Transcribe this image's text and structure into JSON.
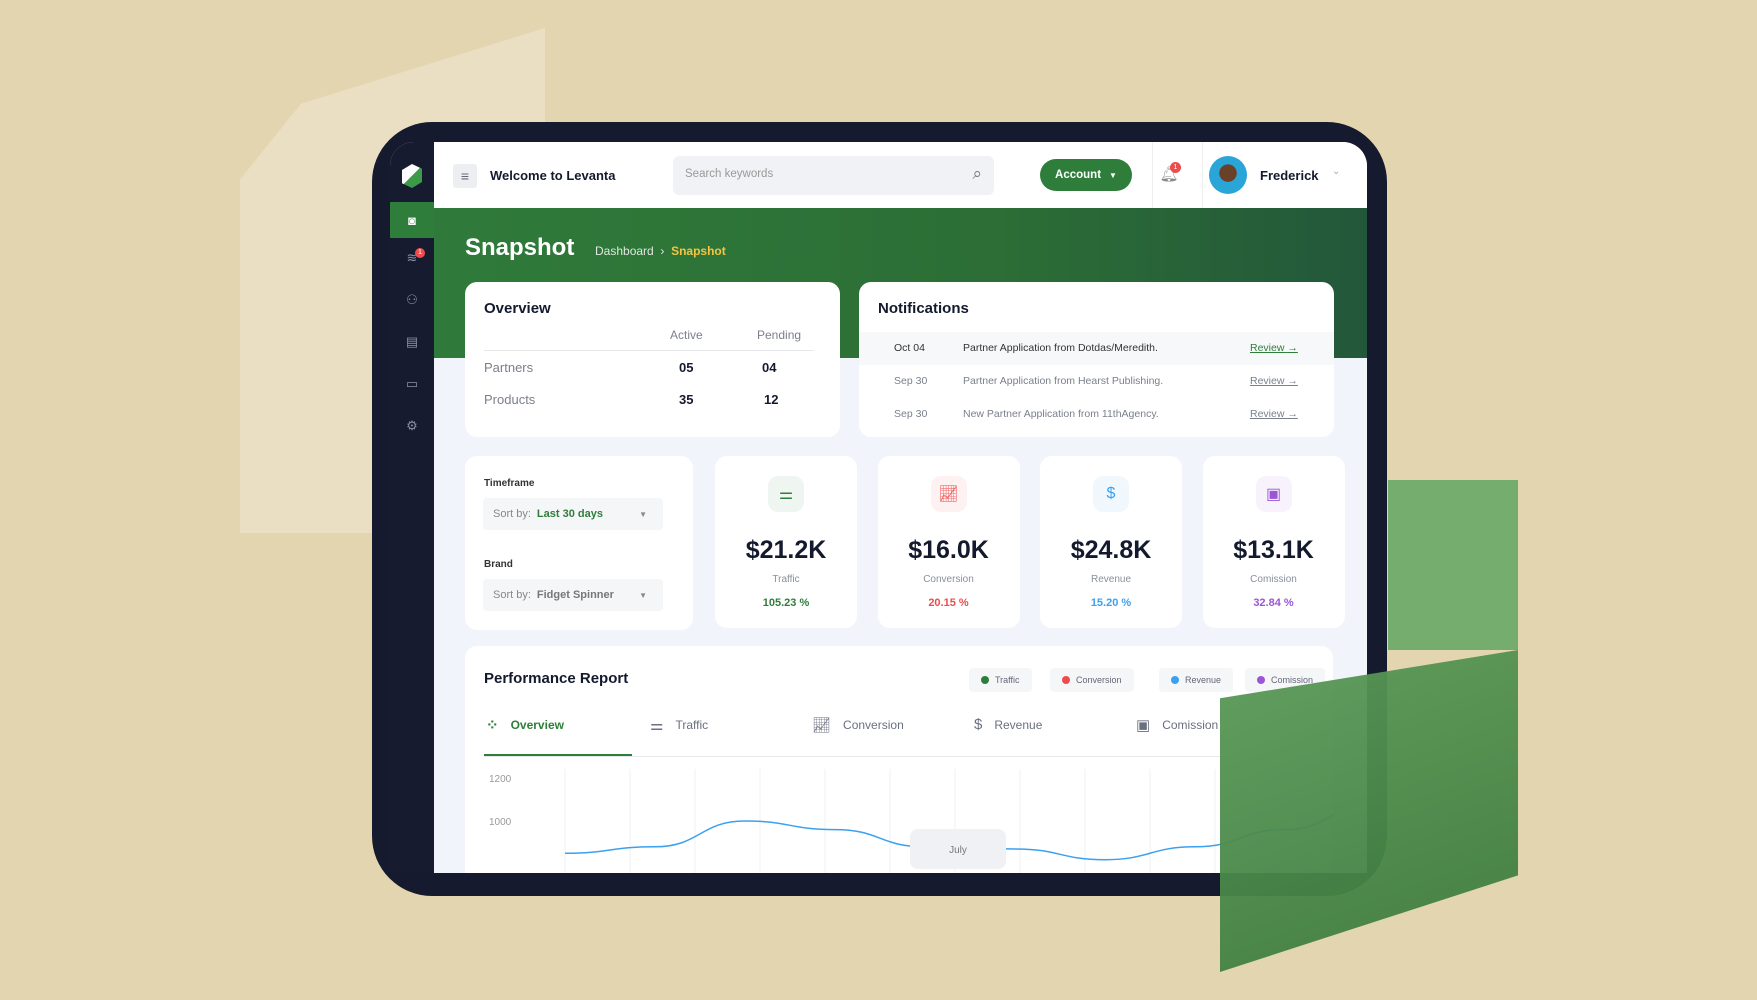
{
  "header": {
    "title": "Welcome to Levanta",
    "search_placeholder": "Search keywords",
    "account_label": "Account",
    "notification_count": "1",
    "user_name": "Frederick"
  },
  "sidebar": {
    "items": [
      {
        "icon": "camera-icon",
        "active": true
      },
      {
        "icon": "layers-icon",
        "badge": "1"
      },
      {
        "icon": "users-icon"
      },
      {
        "icon": "document-icon"
      },
      {
        "icon": "card-icon"
      },
      {
        "icon": "gear-icon"
      }
    ]
  },
  "page": {
    "title": "Snapshot",
    "breadcrumb": [
      "Dashboard",
      "Snapshot"
    ]
  },
  "overview": {
    "title": "Overview",
    "columns": [
      "Active",
      "Pending"
    ],
    "rows": [
      {
        "label": "Partners",
        "active": "05",
        "pending": "04"
      },
      {
        "label": "Products",
        "active": "35",
        "pending": "12"
      }
    ]
  },
  "notifications": {
    "title": "Notifications",
    "items": [
      {
        "date": "Oct 04",
        "text": "Partner Application from Dotdas/Meredith.",
        "action": "Review"
      },
      {
        "date": "Sep 30",
        "text": "Partner Application from Hearst Publishing.",
        "action": "Review"
      },
      {
        "date": "Sep 30",
        "text": "New Partner Application from 11thAgency.",
        "action": "Review"
      }
    ]
  },
  "filters": {
    "timeframe_label": "Timeframe",
    "timeframe_prefix": "Sort by:",
    "timeframe_value": "Last 30 days",
    "brand_label": "Brand",
    "brand_prefix": "Sort by:",
    "brand_value": "Fidget Spinner"
  },
  "stats": [
    {
      "value": "$21.2K",
      "label": "Traffic",
      "pct": "105.23 %",
      "color": "#2f7d3b",
      "icon": "sliders-icon"
    },
    {
      "value": "$16.0K",
      "label": "Conversion",
      "pct": "20.15 %",
      "color": "#ef4b4b",
      "icon": "trend-chart-icon"
    },
    {
      "value": "$24.8K",
      "label": "Revenue",
      "pct": "15.20 %",
      "color": "#3aa1f0",
      "icon": "dollar-bill-icon"
    },
    {
      "value": "$13.1K",
      "label": "Comission",
      "pct": "32.84 %",
      "color": "#9b55d6",
      "icon": "cash-icon"
    }
  ],
  "performance": {
    "title": "Performance Report",
    "legend": [
      {
        "label": "Traffic",
        "color": "#2f7d3b"
      },
      {
        "label": "Conversion",
        "color": "#ef4b4b"
      },
      {
        "label": "Revenue",
        "color": "#3aa1f0"
      },
      {
        "label": "Comission",
        "color": "#9b55d6"
      }
    ],
    "tabs": [
      {
        "label": "Overview",
        "icon": "grid-icon",
        "active": true
      },
      {
        "label": "Traffic",
        "icon": "sliders-icon"
      },
      {
        "label": "Conversion",
        "icon": "trend-chart-icon"
      },
      {
        "label": "Revenue",
        "icon": "dollar-bill-icon"
      },
      {
        "label": "Comission",
        "icon": "cash-icon"
      }
    ],
    "tooltip": "July"
  },
  "chart_data": {
    "type": "line",
    "y_ticks": [
      "1200",
      "1000"
    ],
    "series": [
      {
        "color": "#3aa1f0",
        "values": [
          850,
          880,
          1000,
          960,
          880,
          870,
          820,
          880,
          960,
          1080
        ]
      }
    ]
  }
}
